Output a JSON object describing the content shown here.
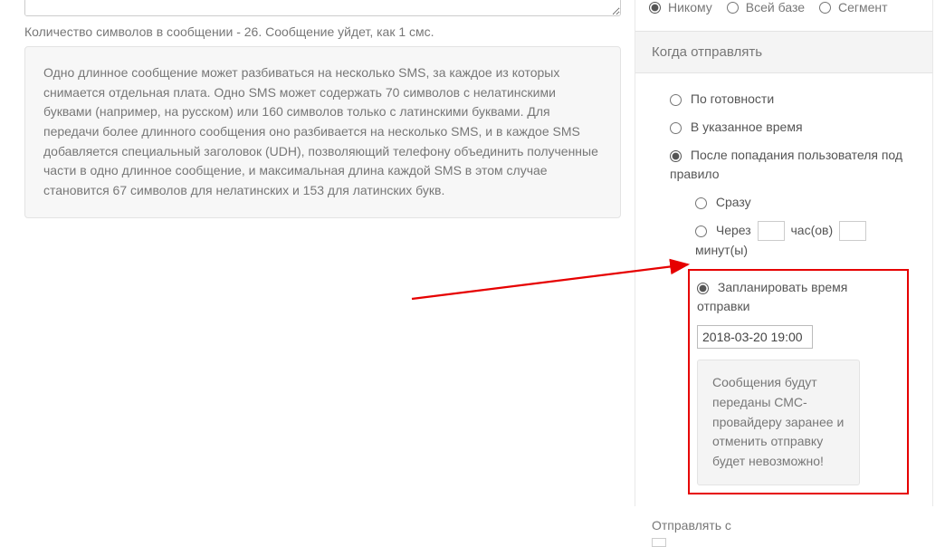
{
  "left": {
    "char_count": "Количество символов в сообщении - 26. Сообщение уйдет, как 1 смс.",
    "info": "Одно длинное сообщение может разбиваться на несколько SMS, за каждое из которых снимается отдельная плата. Одно SMS может содержать 70 символов с нелатинскими буквами (например, на русском) или 160 символов только с латинскими буквами. Для передачи более длинного сообщения оно разбивается на несколько SMS, и в каждое SMS добавляется специальный заголовок (UDH), позволяющий телефону объединить полученные части в одно длинное сообщение, и максимальная длина каждой SMS в этом случае становится 67 символов для нелатинских и 153 для латинских букв."
  },
  "audience": {
    "none": "Никому",
    "all": "Всей базе",
    "segment": "Сегмент"
  },
  "when": {
    "title": "Когда отправлять",
    "ready": "По готовности",
    "at_time": "В указанное время",
    "after_rule": "После попадания пользователя под правило",
    "immediately": "Сразу",
    "through": "Через",
    "hours": "час(ов)",
    "minutes": "минут(ы)",
    "schedule": "Запланировать время отправки",
    "dt_value": "2018-03-20 19:00",
    "warning": "Сообщения будут переданы СМС-провайдеру заранее и отменить отправку будет невозможно!"
  },
  "send_from": "Отправлять с"
}
